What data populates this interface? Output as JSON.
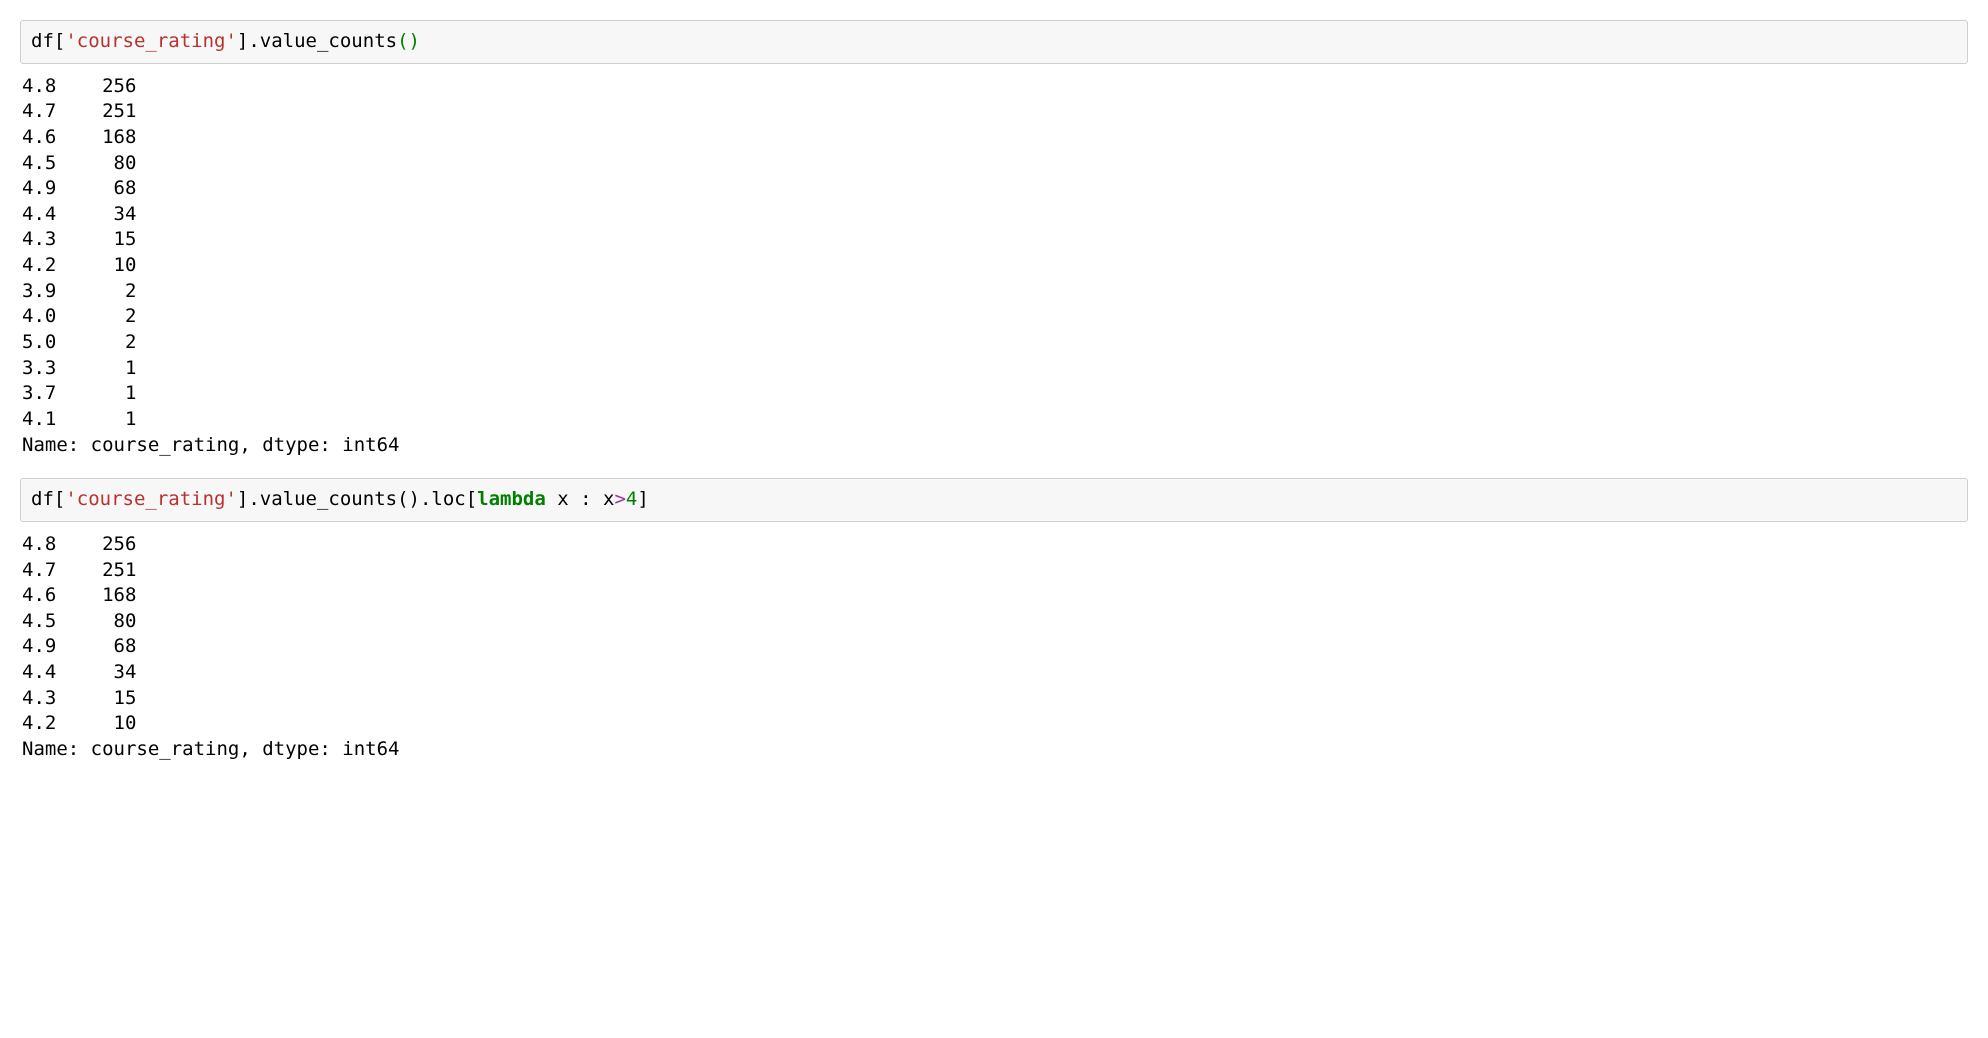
{
  "cells": [
    {
      "code_tokens": [
        {
          "t": "df[",
          "c": "tok-plain"
        },
        {
          "t": "'course_rating'",
          "c": "tok-str"
        },
        {
          "t": "].value_counts",
          "c": "tok-plain"
        },
        {
          "t": "()",
          "c": "tok-paren-green"
        }
      ],
      "output_lines": [
        "4.8    256",
        "4.7    251",
        "4.6    168",
        "4.5     80",
        "4.9     68",
        "4.4     34",
        "4.3     15",
        "4.2     10",
        "3.9      2",
        "4.0      2",
        "5.0      2",
        "3.3      1",
        "3.7      1",
        "4.1      1",
        "Name: course_rating, dtype: int64"
      ]
    },
    {
      "code_tokens": [
        {
          "t": "df[",
          "c": "tok-plain"
        },
        {
          "t": "'course_rating'",
          "c": "tok-str"
        },
        {
          "t": "].value_counts().loc",
          "c": "tok-plain"
        },
        {
          "t": "[",
          "c": "tok-bracket"
        },
        {
          "t": "lambda",
          "c": "tok-kw"
        },
        {
          "t": " x : x",
          "c": "tok-plain"
        },
        {
          "t": ">",
          "c": "tok-op"
        },
        {
          "t": "4",
          "c": "tok-num"
        },
        {
          "t": "]",
          "c": "tok-bracket"
        }
      ],
      "output_lines": [
        "4.8    256",
        "4.7    251",
        "4.6    168",
        "4.5     80",
        "4.9     68",
        "4.4     34",
        "4.3     15",
        "4.2     10",
        "Name: course_rating, dtype: int64"
      ]
    }
  ]
}
